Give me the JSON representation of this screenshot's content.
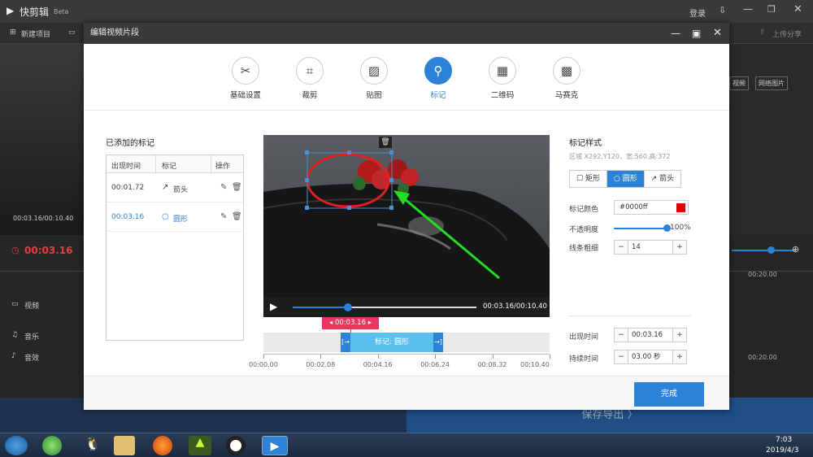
{
  "app": {
    "title": "快剪辑",
    "beta": "Beta",
    "login": "登录",
    "toolbar_new": "新建项目",
    "upload_share": "上传分享",
    "video_label": "视频",
    "web_image": "网络图片",
    "preview_time": "00:03.16/00:10.40",
    "current_time": "00:03.16",
    "track_video": "视频",
    "track_music": "音乐",
    "track_sfx": "音效",
    "ruler_right": "00:20.00",
    "export": "保存导出 〉"
  },
  "taskbar": {
    "time": "7:03",
    "date": "2019/4/3"
  },
  "dialog": {
    "title": "编辑视频片段",
    "tabs": [
      {
        "label": "基础设置",
        "icon": "scissors-icon",
        "glyph": "✂"
      },
      {
        "label": "裁剪",
        "icon": "crop-icon",
        "glyph": "⌗"
      },
      {
        "label": "贴图",
        "icon": "image-icon",
        "glyph": "▨"
      },
      {
        "label": "标记",
        "icon": "pin-icon",
        "glyph": "⚲"
      },
      {
        "label": "二维码",
        "icon": "qrcode-icon",
        "glyph": "▦"
      },
      {
        "label": "马赛克",
        "icon": "mosaic-icon",
        "glyph": "▩"
      }
    ],
    "active_tab": 3,
    "marks_title": "已添加的标记",
    "marks_headers": [
      "出现时间",
      "标记",
      "操作"
    ],
    "marks": [
      {
        "time": "00:01.72",
        "type": "箭头",
        "glyph": "↗"
      },
      {
        "time": "00:03.16",
        "type": "圆形",
        "glyph": "○"
      }
    ],
    "player": {
      "time": "00:03.16/00:10.40",
      "progress": 0.3
    },
    "timeline": {
      "playhead": "00:03.16",
      "clip_label": "标记: 圆形",
      "ticks": [
        "00:00.00",
        "00:02.08",
        "00:04.16",
        "00:06.24",
        "00:08.32",
        "00:10.40"
      ]
    },
    "style": {
      "title": "标记样式",
      "area": "区域 X292,Y120，宽:560,高:372",
      "shapes": [
        "矩形",
        "圆形",
        "箭头"
      ],
      "selected_shape": 1,
      "color_label": "标记颜色",
      "color_value": "#0000ff",
      "color_swatch": "#e00000",
      "opacity_label": "不透明度",
      "opacity_value": "100%",
      "opacity": 1.0,
      "line_label": "线条粗细",
      "line_value": "14",
      "appear_label": "出现时间",
      "appear_value": "00:03.16",
      "duration_label": "持续时间",
      "duration_value": "03.00 秒"
    },
    "done": "完成"
  },
  "colors": {
    "accent": "#2c82d6",
    "mark_red": "#e02020",
    "arrow_green": "#22dd22",
    "clip_blue": "#5bc0f0",
    "playhead_red": "#e8365d"
  }
}
